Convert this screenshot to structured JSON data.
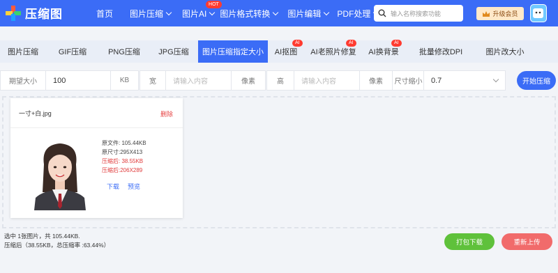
{
  "brand": {
    "name": "压缩图",
    "accent": "#3b6cf6"
  },
  "nav": {
    "items": [
      {
        "label": "首页",
        "dropdown": false
      },
      {
        "label": "图片压缩",
        "dropdown": true
      },
      {
        "label": "图片AI",
        "dropdown": true,
        "badge": "HOT"
      },
      {
        "label": "图片格式转换",
        "dropdown": true
      },
      {
        "label": "图片编辑",
        "dropdown": true
      },
      {
        "label": "PDF处理",
        "dropdown": true
      }
    ],
    "search_placeholder": "输入名称搜索功能",
    "upgrade_label": "升级会员"
  },
  "tabs": [
    {
      "label": "图片压缩",
      "badge": ""
    },
    {
      "label": "GIF压缩",
      "badge": ""
    },
    {
      "label": "PNG压缩",
      "badge": ""
    },
    {
      "label": "JPG压缩",
      "badge": ""
    },
    {
      "label": "图片压缩指定大小",
      "badge": "",
      "active": true
    },
    {
      "label": "AI抠图",
      "badge": "AI"
    },
    {
      "label": "AI老照片修复",
      "badge": "AI"
    },
    {
      "label": "AI换背景",
      "badge": "AI"
    },
    {
      "label": "批量修改DPI",
      "badge": ""
    },
    {
      "label": "图片改大小",
      "badge": ""
    }
  ],
  "options": {
    "target_size_label": "期望大小",
    "target_size_value": "100",
    "target_size_unit": "KB",
    "width_label": "宽",
    "width_placeholder": "请输入内容",
    "width_unit": "像素",
    "height_label": "高",
    "height_placeholder": "请输入内容",
    "height_unit": "像素",
    "scale_label": "尺寸缩小",
    "scale_value": "0.7",
    "start_label": "开始压缩"
  },
  "file": {
    "name": "一寸+白.jpg",
    "delete_label": "删除",
    "original_size": "原文件: 105.44KB",
    "original_dims": "原尺寸:295X413",
    "compressed_size": "压缩后: 38.55KB",
    "compressed_dims": "压缩后:206X289",
    "download_label": "下载",
    "preview_label": "预览"
  },
  "summary": {
    "line1": "选中 1张图片，共 105.44KB.",
    "line2": "压缩后（38.55KB，总压缩率 :63.44%）"
  },
  "actions": {
    "pack_download": "打包下载",
    "reupload": "重新上传"
  }
}
